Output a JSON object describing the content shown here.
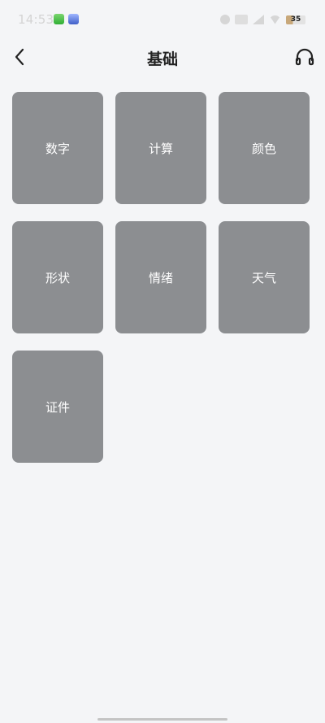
{
  "status_bar": {
    "time": "14:53",
    "battery": "35"
  },
  "header": {
    "title": "基础",
    "back_icon": "chevron-left-icon",
    "audio_icon": "headphones-icon"
  },
  "categories": [
    {
      "label": "数字"
    },
    {
      "label": "计算"
    },
    {
      "label": "颜色"
    },
    {
      "label": "形状"
    },
    {
      "label": "情绪"
    },
    {
      "label": "天气"
    },
    {
      "label": "证件"
    }
  ],
  "colors": {
    "background": "#f4f5f7",
    "card": "#8c8e91",
    "card_text": "#ffffff",
    "title_text": "#222222"
  }
}
